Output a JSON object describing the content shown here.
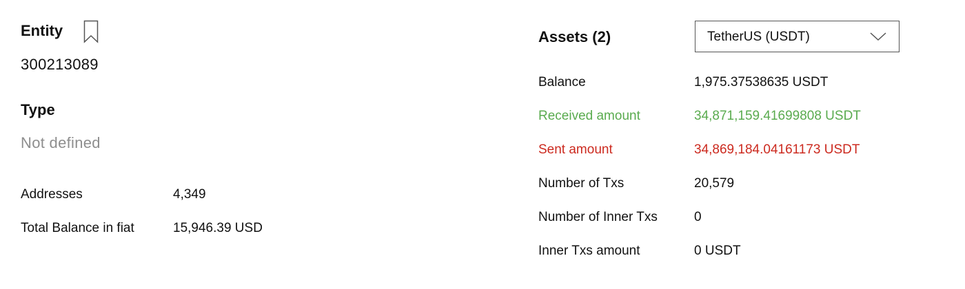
{
  "entity": {
    "title": "Entity",
    "value": "300213089"
  },
  "type": {
    "title": "Type",
    "value": "Not defined"
  },
  "summary": {
    "addresses_label": "Addresses",
    "addresses_value": "4,349",
    "total_balance_label": "Total Balance in fiat",
    "total_balance_value": "15,946.39 USD"
  },
  "assets": {
    "title": "Assets (2)",
    "selected_asset": "TetherUS (USDT)",
    "rows": {
      "balance_label": "Balance",
      "balance_value": "1,975.37538635 USDT",
      "received_label": "Received amount",
      "received_value": "34,871,159.41699808 USDT",
      "sent_label": "Sent amount",
      "sent_value": "34,869,184.04161173 USDT",
      "txs_label": "Number of Txs",
      "txs_value": "20,579",
      "inner_txs_label": "Number of Inner Txs",
      "inner_txs_value": "0",
      "inner_amount_label": "Inner Txs amount",
      "inner_amount_value": "0 USDT"
    }
  },
  "colors": {
    "received": "#5aab4f",
    "sent": "#cc2a1f",
    "muted": "#8e8e8e"
  },
  "icons": {
    "bookmark": "bookmark-icon",
    "dropdown": "chevron-down-icon"
  }
}
